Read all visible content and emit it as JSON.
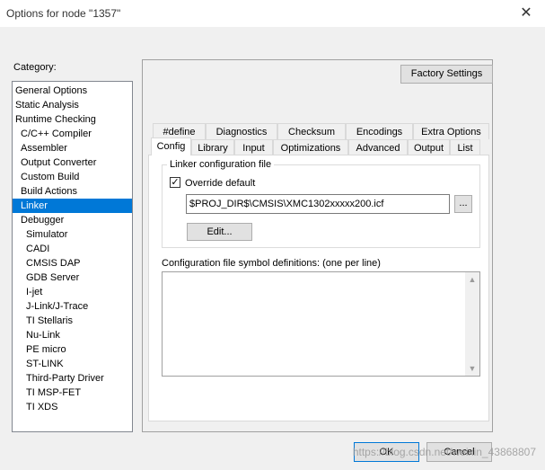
{
  "window": {
    "title": "Options for node \"1357\""
  },
  "category": {
    "label": "Category:",
    "items": [
      {
        "label": "General Options",
        "level": 0
      },
      {
        "label": "Static Analysis",
        "level": 0
      },
      {
        "label": "Runtime Checking",
        "level": 0
      },
      {
        "label": "C/C++ Compiler",
        "level": 1
      },
      {
        "label": "Assembler",
        "level": 1
      },
      {
        "label": "Output Converter",
        "level": 1
      },
      {
        "label": "Custom Build",
        "level": 1
      },
      {
        "label": "Build Actions",
        "level": 1
      },
      {
        "label": "Linker",
        "level": 1,
        "selected": true
      },
      {
        "label": "Debugger",
        "level": 1
      },
      {
        "label": "Simulator",
        "level": 2
      },
      {
        "label": "CADI",
        "level": 2
      },
      {
        "label": "CMSIS DAP",
        "level": 2
      },
      {
        "label": "GDB Server",
        "level": 2
      },
      {
        "label": "I-jet",
        "level": 2
      },
      {
        "label": "J-Link/J-Trace",
        "level": 2
      },
      {
        "label": "TI Stellaris",
        "level": 2
      },
      {
        "label": "Nu-Link",
        "level": 2
      },
      {
        "label": "PE micro",
        "level": 2
      },
      {
        "label": "ST-LINK",
        "level": 2
      },
      {
        "label": "Third-Party Driver",
        "level": 2
      },
      {
        "label": "TI MSP-FET",
        "level": 2
      },
      {
        "label": "TI XDS",
        "level": 2
      }
    ]
  },
  "factory_settings_label": "Factory Settings",
  "tabs_row1": [
    "#define",
    "Diagnostics",
    "Checksum",
    "Encodings",
    "Extra Options"
  ],
  "tabs_row2": [
    "Config",
    "Library",
    "Input",
    "Optimizations",
    "Advanced",
    "Output",
    "List"
  ],
  "active_tab": "Config",
  "linker_config": {
    "group_title": "Linker configuration file",
    "override_label": "Override default",
    "override_checked": true,
    "path_value": "$PROJ_DIR$\\CMSIS\\XMC1302xxxxx200.icf",
    "browse_label": "...",
    "edit_label": "Edit..."
  },
  "symbol_defs_label": "Configuration file symbol definitions: (one per line)",
  "buttons": {
    "ok": "OK",
    "cancel": "Cancel"
  },
  "watermark": "https://blog.csdn.net/weixin_43868807"
}
